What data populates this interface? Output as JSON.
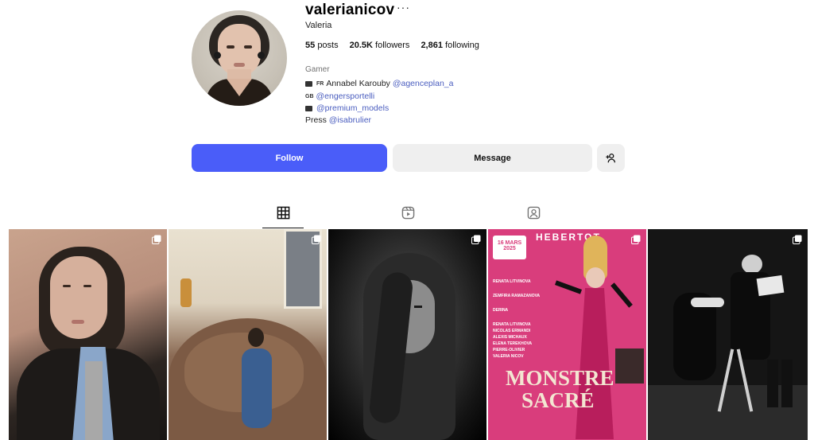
{
  "profile": {
    "username": "valerianicov",
    "more_icon": "···",
    "full_name": "Valeria",
    "stats": {
      "posts": "55",
      "posts_label": "posts",
      "followers": "20.5K",
      "followers_label": "followers",
      "following": "2,861",
      "following_label": "following"
    },
    "category": "Gamer",
    "bio": {
      "line1_flag": "FR",
      "line1_text": "Annabel Karouby ",
      "line1_link": "@agenceplan_a",
      "line2_flag": "GB",
      "line2_link": "@engersportelli",
      "line3_link": "@premium_models",
      "line4_text": "Press ",
      "line4_link": "@isabrulier"
    }
  },
  "actions": {
    "follow_label": "Follow",
    "message_label": "Message",
    "add_user_icon": "person-plus-icon"
  },
  "tabs": [
    {
      "name": "posts",
      "icon": "grid-icon",
      "active": true
    },
    {
      "name": "reels",
      "icon": "reels-icon",
      "active": false
    },
    {
      "name": "tagged",
      "icon": "tagged-icon",
      "active": false
    }
  ],
  "posts": [
    {
      "type": "carousel",
      "icon": "multi-image-icon"
    },
    {
      "type": "carousel",
      "icon": "multi-image-icon"
    },
    {
      "type": "carousel",
      "icon": "multi-image-icon"
    },
    {
      "type": "carousel",
      "icon": "multi-image-icon",
      "poster": {
        "theatre": "HEBERTOT",
        "date_day": "16 MARS",
        "date_year": "2025",
        "names": [
          "RENATA LITVINOVA",
          "ZEMFIRA RAMAZANOVA",
          "DERINA",
          "RENATA LITVINOVA",
          "NICOLAS ERMANDI",
          "ALEXIS MICHAUX",
          "ELENA TEREKHOVA",
          "PIERRE-OLIVIER",
          "VALERIA NICOV"
        ],
        "title_line1": "MONSTRE",
        "title_line2": "SACRÉ"
      }
    },
    {
      "type": "carousel",
      "icon": "multi-image-icon"
    }
  ],
  "colors": {
    "accent": "#4a5df9",
    "link": "#4a5dbf",
    "button_secondary": "#efefef"
  }
}
